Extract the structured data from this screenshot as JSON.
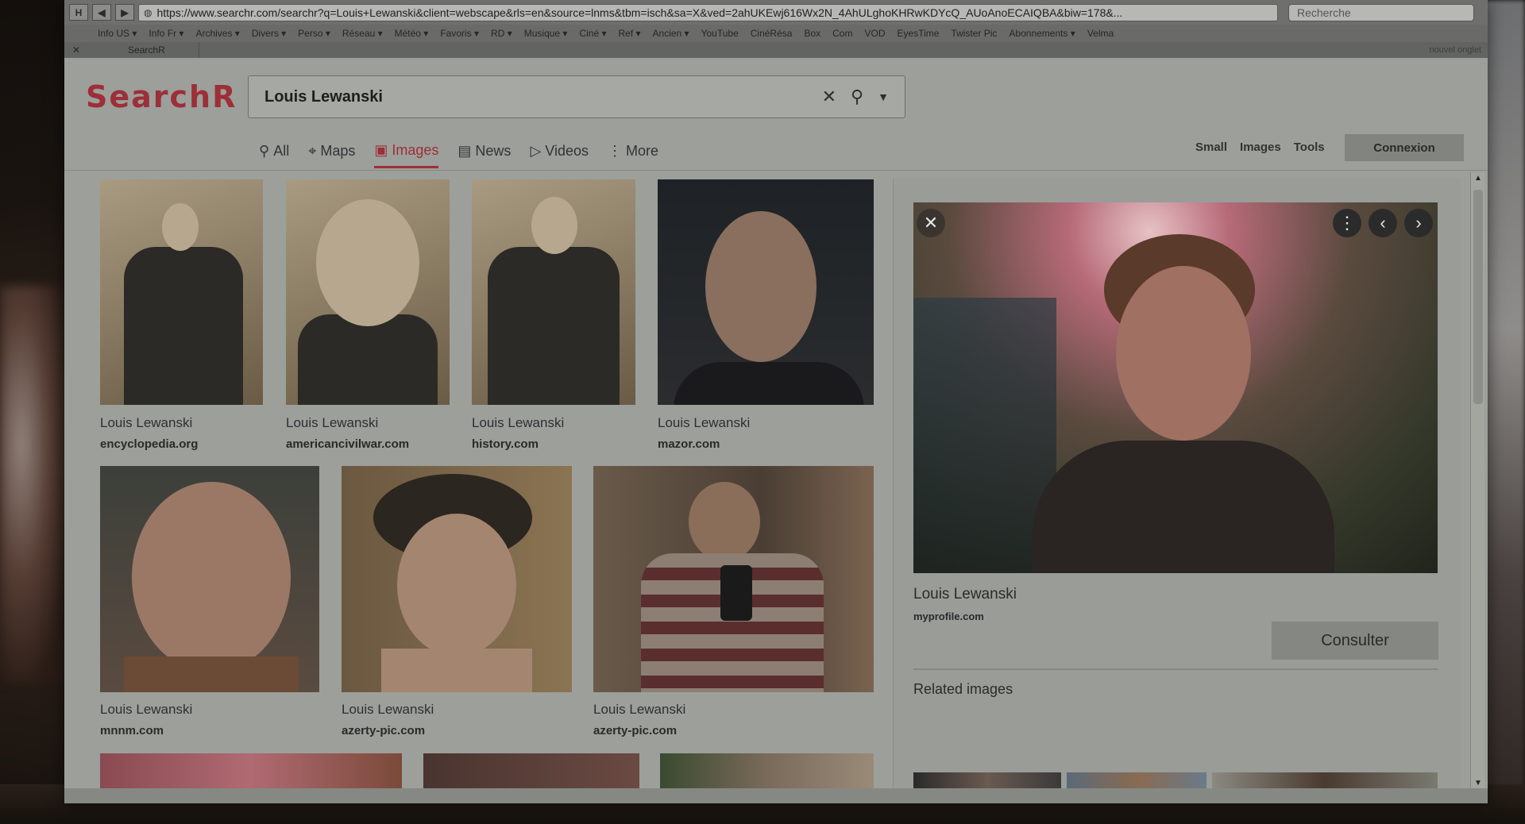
{
  "browser": {
    "url": "https://www.searchr.com/searchr?q=Louis+Lewanski&client=webscape&rls=en&source=lnms&tbm=isch&sa=X&ved=2ahUKEwj616Wx2N_4AhULghoKHRwKDYcQ_AUoAnoECAIQBA&biw=178&...",
    "search_placeholder": "Recherche",
    "home_label": "H",
    "bookmarks": [
      "Info US ▾",
      "Info Fr ▾",
      "Archives ▾",
      "Divers ▾",
      "Perso ▾",
      "Réseau ▾",
      "Météo ▾",
      "Favoris ▾",
      "RD ▾",
      "Musique ▾",
      "Ciné ▾",
      "Ref ▾",
      "Ancien ▾",
      "YouTube",
      "CinéRésa",
      "Box",
      "Com",
      "VOD",
      "EyesTime",
      "Twister Pic",
      "Abonnements ▾",
      "Velma"
    ],
    "tab_title": "SearchR",
    "new_tab": "nouvel onglet"
  },
  "site": {
    "logo": "SearchR",
    "query": "Louis Lewanski",
    "tabs": [
      "All",
      "Maps",
      "Images",
      "News",
      "Videos",
      "More"
    ],
    "active_tab": "Images",
    "right_links": [
      "Small",
      "Images",
      "Tools"
    ],
    "login": "Connexion"
  },
  "results": [
    {
      "caption": "Louis Lewanski",
      "source": "encyclopedia.org"
    },
    {
      "caption": "Louis Lewanski",
      "source": "americancivilwar.com"
    },
    {
      "caption": "Louis Lewanski",
      "source": "history.com"
    },
    {
      "caption": "Louis Lewanski",
      "source": "mazor.com"
    },
    {
      "caption": "Louis Lewanski",
      "source": "mnnm.com"
    },
    {
      "caption": "Louis Lewanski",
      "source": "azerty-pic.com"
    },
    {
      "caption": "Louis Lewanski",
      "source": "azerty-pic.com"
    }
  ],
  "panel": {
    "title": "Louis Lewanski",
    "source": "myprofile.com",
    "consult": "Consulter",
    "related": "Related images"
  },
  "colors": {
    "brand": "#9c2f37",
    "page_bg": "#9d9f9b"
  }
}
